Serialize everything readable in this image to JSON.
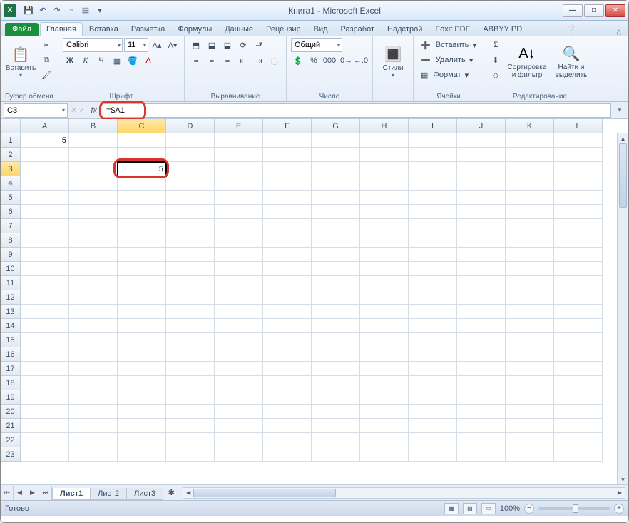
{
  "title": "Книга1  -  Microsoft Excel",
  "qat_icons": [
    "save-icon",
    "undo-icon",
    "redo-icon",
    "new-icon",
    "open-icon",
    "print-icon"
  ],
  "window_buttons": {
    "min": "—",
    "max": "□",
    "close": "✕"
  },
  "file_tab": "Файл",
  "tabs": [
    "Главная",
    "Вставка",
    "Разметка",
    "Формулы",
    "Данные",
    "Рецензир",
    "Вид",
    "Разработ",
    "Надстрой",
    "Foxit PDF",
    "ABBYY PD"
  ],
  "active_tab": 0,
  "ribbon": {
    "clipboard": {
      "paste": "Вставить",
      "label": "Буфер обмена"
    },
    "font": {
      "name": "Calibri",
      "size": "11",
      "label": "Шрифт"
    },
    "align": {
      "label": "Выравнивание"
    },
    "number": {
      "format": "Общий",
      "label": "Число"
    },
    "styles": {
      "btn": "Стили",
      "label": ""
    },
    "cells": {
      "insert": "Вставить",
      "delete": "Удалить",
      "format": "Формат",
      "label": "Ячейки"
    },
    "editing": {
      "sort": "Сортировка и фильтр",
      "find": "Найти и выделить",
      "label": "Редактирование"
    }
  },
  "namebox": "C3",
  "formula": "=$A1",
  "columns": [
    "A",
    "B",
    "C",
    "D",
    "E",
    "F",
    "G",
    "H",
    "I",
    "J",
    "K",
    "L"
  ],
  "row_count": 23,
  "active_col": 2,
  "active_row": 2,
  "cells": {
    "A1": "5",
    "C3": "5"
  },
  "sheets": [
    "Лист1",
    "Лист2",
    "Лист3"
  ],
  "active_sheet": 0,
  "status": "Готово",
  "zoom": "100%"
}
